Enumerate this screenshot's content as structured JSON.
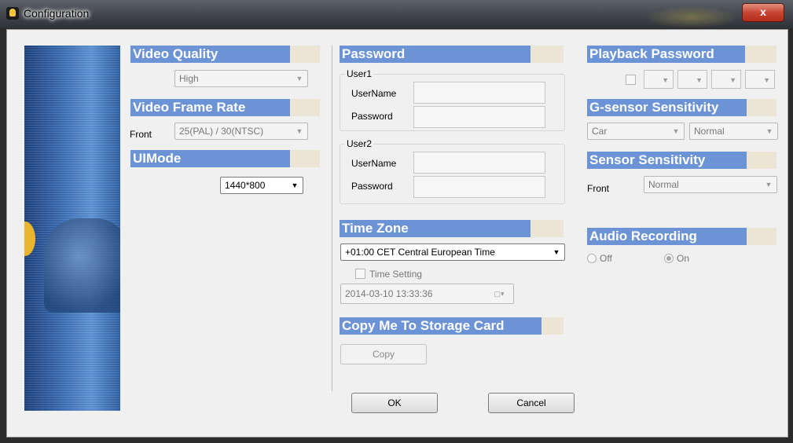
{
  "window": {
    "title": "Configuration",
    "close_label": "x"
  },
  "video_quality": {
    "header": "Video Quality",
    "value": "High"
  },
  "video_frame_rate": {
    "header": "Video Frame Rate",
    "label": "Front",
    "value": "25(PAL) / 30(NTSC)"
  },
  "ui_mode": {
    "header": "UIMode",
    "value": "1440*800"
  },
  "password": {
    "header": "Password",
    "user1": {
      "caption": "User1",
      "username_label": "UserName",
      "password_label": "Password",
      "username_value": "",
      "password_value": ""
    },
    "user2": {
      "caption": "User2",
      "username_label": "UserName",
      "password_label": "Password",
      "username_value": "",
      "password_value": ""
    }
  },
  "time_zone": {
    "header": "Time Zone",
    "value": "+01:00 CET Central European Time",
    "time_setting_label": "Time Setting",
    "datetime": "2014-03-10 13:33:36"
  },
  "copy": {
    "header": "Copy Me To Storage Card",
    "button": "Copy"
  },
  "playback_password": {
    "header": "Playback Password"
  },
  "gsensor": {
    "header": "G-sensor Sensitivity",
    "vehicle": "Car",
    "level": "Normal"
  },
  "sensor_sensitivity": {
    "header": "Sensor Sensitivity",
    "label": "Front",
    "value": "Normal"
  },
  "audio_recording": {
    "header": "Audio Recording",
    "off_label": "Off",
    "on_label": "On",
    "selected": "On"
  },
  "footer": {
    "ok": "OK",
    "cancel": "Cancel"
  },
  "icons": {
    "dropdown": "chevron-down-icon",
    "calendar": "calendar-icon",
    "app": "app-icon",
    "close": "close-icon"
  }
}
